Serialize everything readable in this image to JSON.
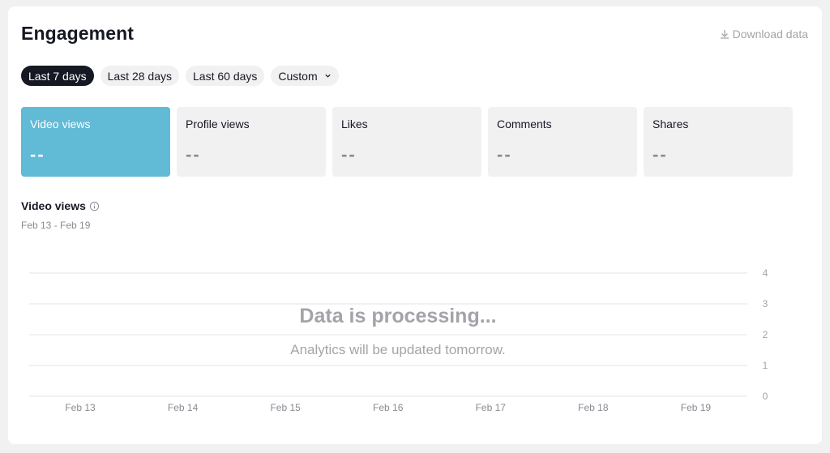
{
  "header": {
    "title": "Engagement",
    "download_label": "Download data",
    "download_icon": "download-icon"
  },
  "ranges": [
    {
      "label": "Last 7 days",
      "active": true
    },
    {
      "label": "Last 28 days",
      "active": false
    },
    {
      "label": "Last 60 days",
      "active": false
    },
    {
      "label": "Custom",
      "active": false,
      "icon": "chevron-down-icon"
    }
  ],
  "metrics": [
    {
      "label": "Video views",
      "value": "--",
      "active": true
    },
    {
      "label": "Profile views",
      "value": "--",
      "active": false
    },
    {
      "label": "Likes",
      "value": "--",
      "active": false
    },
    {
      "label": "Comments",
      "value": "--",
      "active": false
    },
    {
      "label": "Shares",
      "value": "--",
      "active": false
    }
  ],
  "section": {
    "title": "Video views",
    "info_icon": "info-icon",
    "date_range": "Feb 13 - Feb 19"
  },
  "overlay": {
    "title": "Data is processing...",
    "subtitle": "Analytics will be updated tomorrow."
  },
  "colors": {
    "accent": "#61bad6",
    "dark": "#161823",
    "muted": "#a3a4a9",
    "tile_bg": "#f1f1f2"
  },
  "chart_data": {
    "type": "line",
    "title": "",
    "x": [
      "Feb 13",
      "Feb 14",
      "Feb 15",
      "Feb 16",
      "Feb 17",
      "Feb 18",
      "Feb 19"
    ],
    "y_ticks": [
      0,
      1,
      2,
      3,
      4
    ],
    "ylim": [
      0,
      4
    ],
    "series": [],
    "grid": true,
    "xlabel": "",
    "ylabel": ""
  }
}
